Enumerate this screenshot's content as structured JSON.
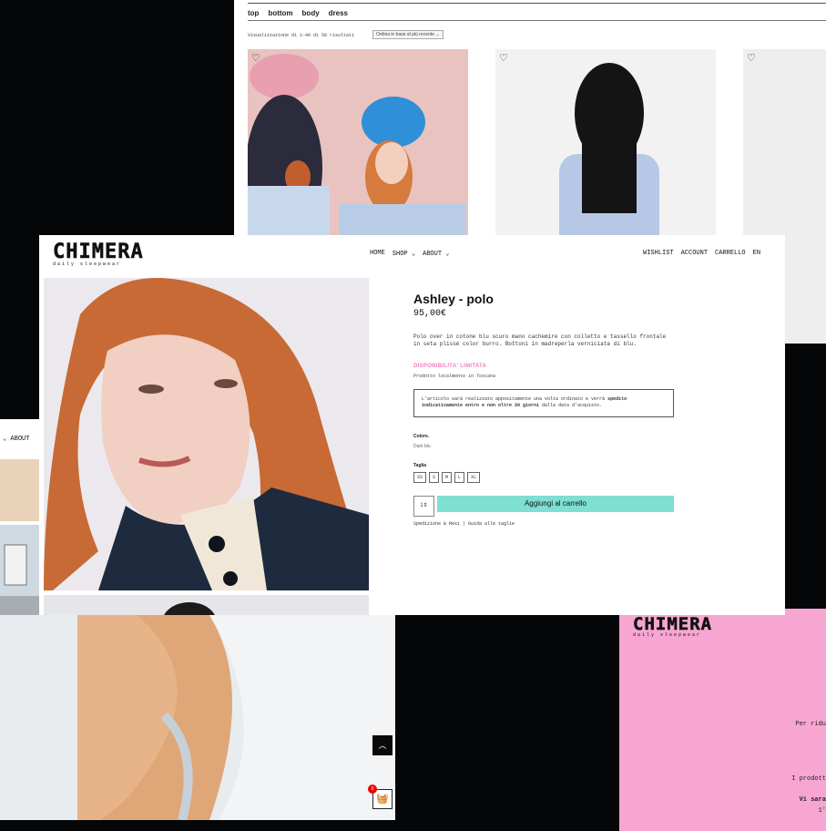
{
  "shop_list": {
    "categories": [
      "top",
      "bottom",
      "body",
      "dress"
    ],
    "results_text": "Visualizzazione di 1–40 di 58 risultati",
    "sort_selected": "Ordina in base al più recente"
  },
  "header": {
    "logo_main": "CHIMERA",
    "logo_sub": "daily sleepwear",
    "nav_left": [
      "HOME",
      "SHOP ⌄",
      "ABOUT ⌄"
    ],
    "nav_right": [
      "WISHLIST",
      "ACCOUNT",
      "CARRELLO",
      "EN"
    ]
  },
  "product": {
    "title": "Ashley - polo",
    "price": "95,00€",
    "description": "Polo over in cotone blu scuro mano cachemire con colletto e tassello frontale in seta plissé color burro. Bottoni in madreperla verniciata di blu.",
    "availability": "DISPONIBILITA' LIMITATA",
    "local_note": "Prodotto localmente in Toscana",
    "notice_a": "L'articolo sarà realizzato appositamente una volta ordinato e verrà",
    "notice_b": "spedito indicativamente entro e non oltre 20 giorni",
    "notice_c": "dalla data d'acquisto.",
    "color_label": "Colore.",
    "color_value": "Dark blu",
    "size_label": "Taglia",
    "sizes": [
      "XS",
      "S",
      "M",
      "L",
      "XL"
    ],
    "qty": "1",
    "add_to_cart": "Aggiungi al carrello",
    "shipping_links": "Spedizione & Resi | Guida alle taglie"
  },
  "cart_badge": "0",
  "left_window": {
    "nav_item": "⌄  ABOUT"
  },
  "pink_window": {
    "logo_main": "CHIMERA",
    "logo_sub": "daily sleepwear",
    "line1": "Per ridu",
    "line2": "I prodott",
    "line3": "Vi sara",
    "line4": "1'"
  },
  "colors": {
    "accent_add_cart": "#7fdfd2",
    "availability_pink": "#e87fc0",
    "badge_red": "#ee0000",
    "pink_bg": "#f7a6d2"
  }
}
